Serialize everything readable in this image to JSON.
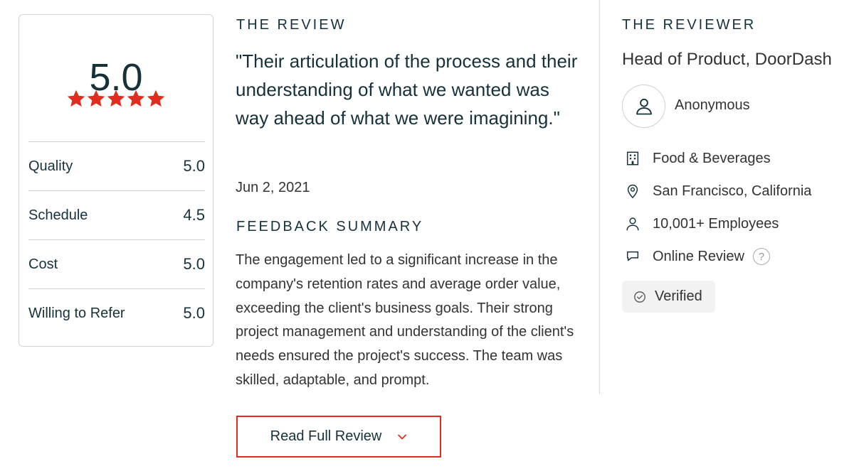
{
  "rating_card": {
    "overall_score": "5.0",
    "star_count": 5,
    "star_color": "#e12d1f",
    "scores": [
      {
        "label": "Quality",
        "value": "5.0"
      },
      {
        "label": "Schedule",
        "value": "4.5"
      },
      {
        "label": "Cost",
        "value": "5.0"
      },
      {
        "label": "Willing to Refer",
        "value": "5.0"
      }
    ]
  },
  "review": {
    "heading": "THE REVIEW",
    "quote": "\"Their articulation of the process and their understanding of what we wanted was way ahead of what we were imagining.\"",
    "date": "Jun 2, 2021",
    "summary_heading": "FEEDBACK SUMMARY",
    "summary_text": "The engagement led to a significant increase in the company's retention rates and average order value, exceeding the client's business goals. Their strong project management and understanding of the client's needs ensured the project's success. The team was skilled, adaptable, and prompt.",
    "read_full_label": "Read Full Review",
    "accent_color": "#e12d1f"
  },
  "reviewer": {
    "heading": "THE REVIEWER",
    "title": "Head of Product, DoorDash",
    "name": "Anonymous",
    "industry": "Food & Beverages",
    "location": "San Francisco, California",
    "employees": "10,001+ Employees",
    "review_type": "Online Review",
    "help_symbol": "?",
    "verified_label": "Verified",
    "icons": [
      "user-icon",
      "building-icon",
      "location-pin-icon",
      "person-icon",
      "chat-bubble-icon",
      "help-icon",
      "check-circle-icon"
    ]
  }
}
